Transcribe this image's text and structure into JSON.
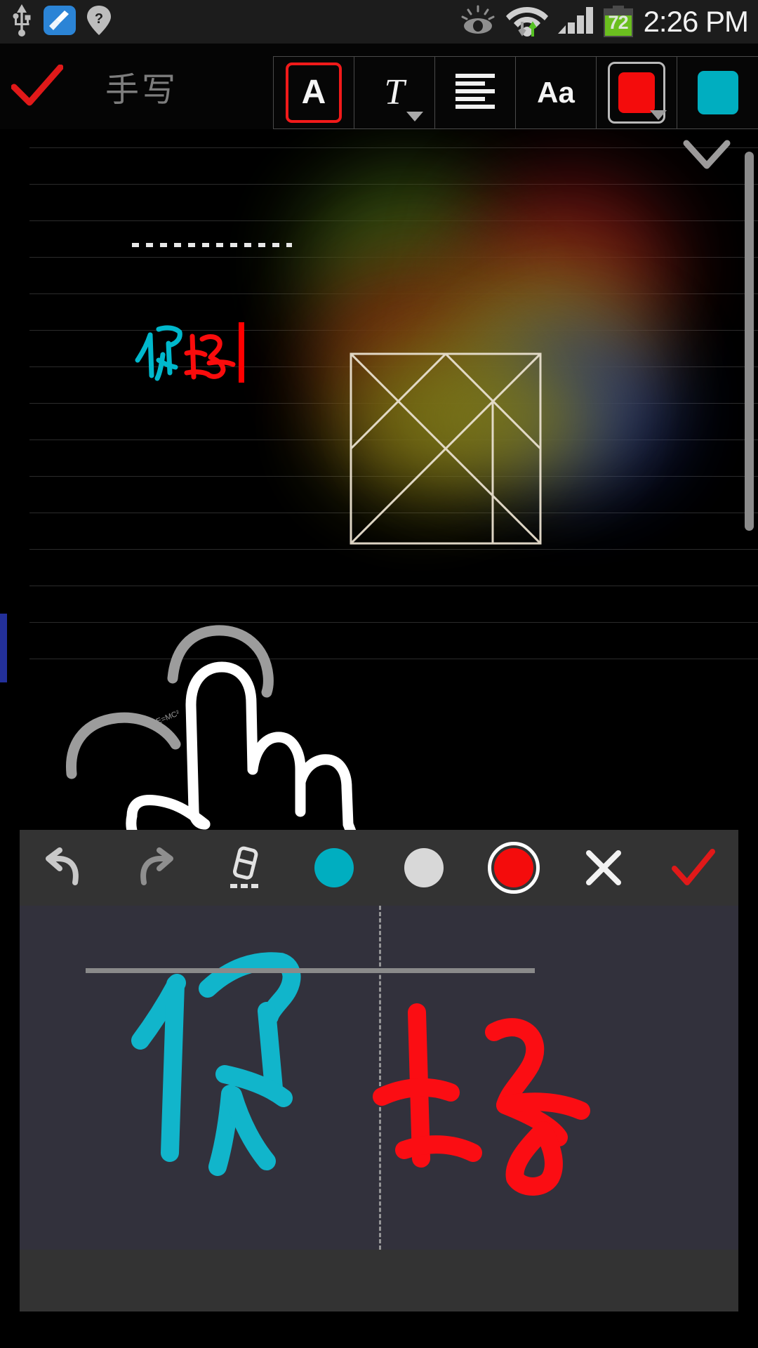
{
  "status_bar": {
    "time": "2:26 PM",
    "battery_percent": "72",
    "icons": [
      {
        "name": "usb-icon",
        "label": "USB connected"
      },
      {
        "name": "cleaner-icon",
        "label": "Cleaner app"
      },
      {
        "name": "location-unknown-icon",
        "label": "Location help"
      },
      {
        "name": "smart-stay-eye-icon",
        "label": "Smart stay"
      },
      {
        "name": "wifi-data-icon",
        "label": "Wi-Fi data transfer"
      },
      {
        "name": "signal-bars-icon",
        "label": "Mobile signal"
      },
      {
        "name": "battery-icon",
        "label": "Battery"
      }
    ]
  },
  "app_bar": {
    "title": "手写",
    "confirm_label": "✓",
    "tools": [
      {
        "name": "text-style-a",
        "glyph": "A",
        "selected": true,
        "has_dropdown": false
      },
      {
        "name": "italic-t",
        "glyph": "T",
        "selected": false,
        "has_dropdown": true
      },
      {
        "name": "align-lines",
        "glyph": "≡",
        "selected": false,
        "has_dropdown": false
      },
      {
        "name": "font-size-aa",
        "glyph": "Aa",
        "selected": false,
        "has_dropdown": false
      },
      {
        "name": "color-red-swatch",
        "glyph": "",
        "selected": false,
        "has_dropdown": true,
        "color": "#f40c0c"
      },
      {
        "name": "color-cyan-swatch",
        "glyph": "",
        "selected": false,
        "has_dropdown": false,
        "color": "#00aec0"
      }
    ]
  },
  "canvas": {
    "collapse_icon": "chevron-down",
    "ink_text": "你好",
    "ink_colors": {
      "first_char": "#00b8cc",
      "second_char": "#fa0c0c",
      "cursor": "#ff0000"
    },
    "annotation_text": "E=MC²",
    "underline_style": "dotted",
    "rule_line_color": "#2b2b2b",
    "rule_line_count": 15,
    "drawing_name": "pointing-hand-sketch",
    "image_name": "tangram-puzzle-diagram",
    "marker_color": "#23309a"
  },
  "ink_toolbar": {
    "buttons": [
      {
        "name": "undo-button",
        "label": "undo"
      },
      {
        "name": "redo-button",
        "label": "redo"
      },
      {
        "name": "eraser-button",
        "label": "eraser"
      },
      {
        "name": "pen-color-cyan",
        "label": "cyan",
        "color": "#00aec0",
        "selected": false
      },
      {
        "name": "pen-color-white",
        "label": "white",
        "color": "#d8d8d8",
        "selected": false
      },
      {
        "name": "pen-color-red",
        "label": "red",
        "color": "#f40c0c",
        "selected": true
      },
      {
        "name": "cancel-button",
        "label": "✕"
      },
      {
        "name": "accept-button",
        "label": "✓"
      }
    ]
  },
  "handwriting_panel": {
    "background": "#32313c",
    "strokes_text": "你好",
    "left_stroke_color": "#11b5cb",
    "right_stroke_color": "#fb0d13",
    "baseline_color": "#8a8a8a",
    "divider_style": "dashed"
  },
  "colors": {
    "accent_red": "#f40c0c",
    "accent_cyan": "#00aec0",
    "toolbar_bg": "#333333",
    "status_bg": "#1c1c1c",
    "canvas_bg": "#000000"
  }
}
